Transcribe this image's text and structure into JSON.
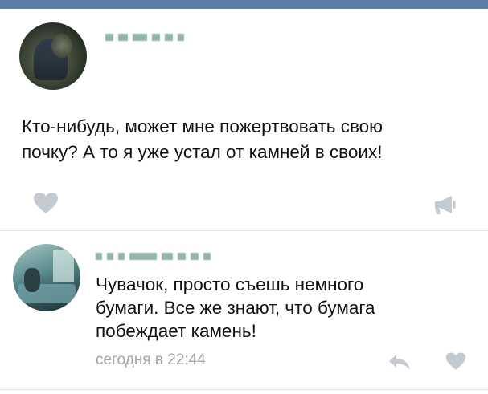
{
  "post": {
    "text": "Кто-нибудь, может мне пожертвовать свою\nпочку? А то я уже устал от камней в своих!"
  },
  "comment": {
    "text": "Чувачок, просто съешь немного\nбумаги. Все же знают, что бумага\nпобеждает камень!",
    "time": "сегодня в 22:44"
  },
  "icons": {
    "post_like": "heart-icon",
    "post_share": "megaphone-icon",
    "comment_reply": "reply-arrow-icon",
    "comment_like": "heart-icon"
  },
  "colors": {
    "header_bar": "#5b7fa6",
    "icon_gray": "#c5cad0",
    "time_text": "#9ea5ad",
    "divider": "#e1e4e8"
  }
}
